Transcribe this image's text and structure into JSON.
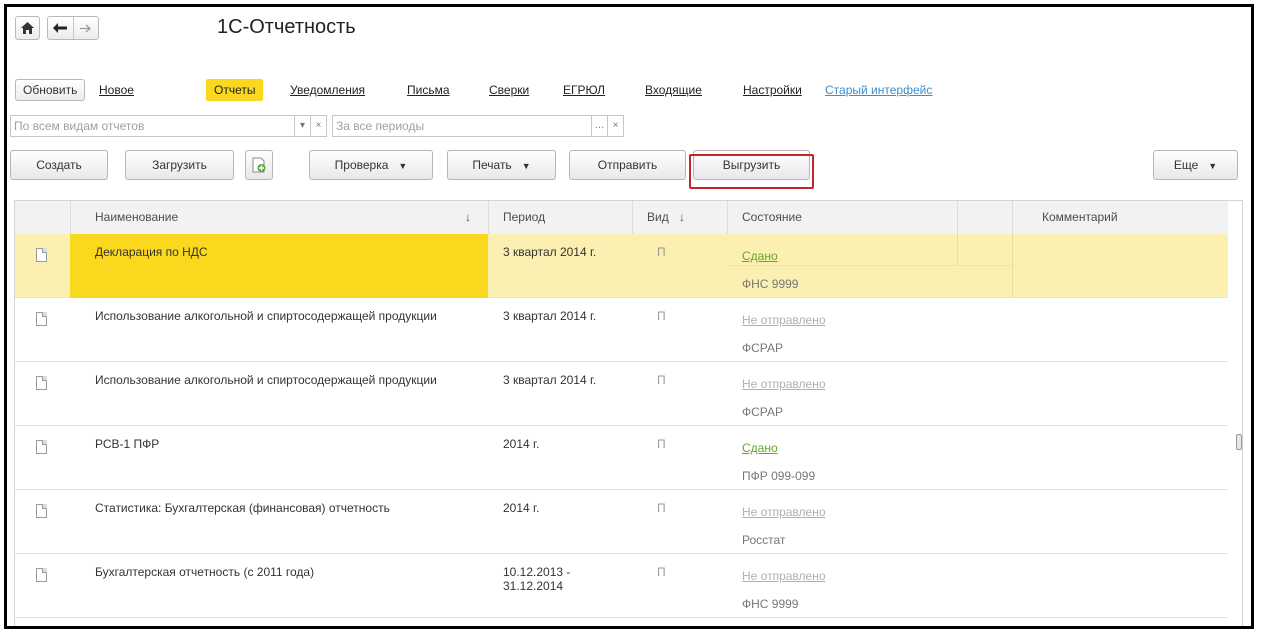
{
  "window": {
    "title": "1С-Отчетность"
  },
  "menu": {
    "refresh": "Обновить",
    "new": "Новое",
    "reports": "Отчеты",
    "notifications": "Уведомления",
    "letters": "Письма",
    "reconciliations": "Сверки",
    "egrul": "ЕГРЮЛ",
    "incoming": "Входящие",
    "settings": "Настройки",
    "old_interface": "Старый интерфейс"
  },
  "filters": {
    "report_type_placeholder": "По всем видам отчетов",
    "period_placeholder": "За все периоды"
  },
  "toolbar": {
    "create": "Создать",
    "load": "Загрузить",
    "check": "Проверка",
    "print": "Печать",
    "send": "Отправить",
    "export": "Выгрузить",
    "more": "Еще"
  },
  "table": {
    "headers": {
      "name": "Наименование",
      "name_sort": "↓",
      "period": "Период",
      "kind": "Вид",
      "kind_sort": "↓",
      "state": "Состояние",
      "comment": "Комментарий"
    },
    "rows": [
      {
        "name": "Декларация по НДС",
        "period": "3 квартал 2014 г.",
        "kind": "П",
        "status": "Сдано",
        "org": "ФНС 9999"
      },
      {
        "name": "Использование алкогольной и спиртосодержащей продукции",
        "period": "3 квартал 2014 г.",
        "kind": "П",
        "status": "Не отправлено",
        "org": "ФСРАР"
      },
      {
        "name": "Использование алкогольной и спиртосодержащей продукции",
        "period": "3 квартал 2014 г.",
        "kind": "П",
        "status": "Не отправлено",
        "org": "ФСРАР"
      },
      {
        "name": "РСВ-1 ПФР",
        "period": "2014 г.",
        "kind": "П",
        "status": "Сдано",
        "org": "ПФР 099-099"
      },
      {
        "name": "Статистика: Бухгалтерская (финансовая) отчетность",
        "period": "2014 г.",
        "kind": "П",
        "status": "Не отправлено",
        "org": "Росстат"
      },
      {
        "name": "Бухгалтерская отчетность (с 2011 года)",
        "period": "10.12.2013 - 31.12.2014",
        "kind": "П",
        "status": "Не отправлено",
        "org": "ФНС 9999"
      }
    ]
  },
  "colors": {
    "accent_yellow": "#fad81e",
    "selected_row": "#fbf0b2",
    "status_ok": "#62a72b",
    "status_pending": "#b0b0b0",
    "highlight_border": "#c0262c",
    "link_blue": "#3a8fcf"
  }
}
